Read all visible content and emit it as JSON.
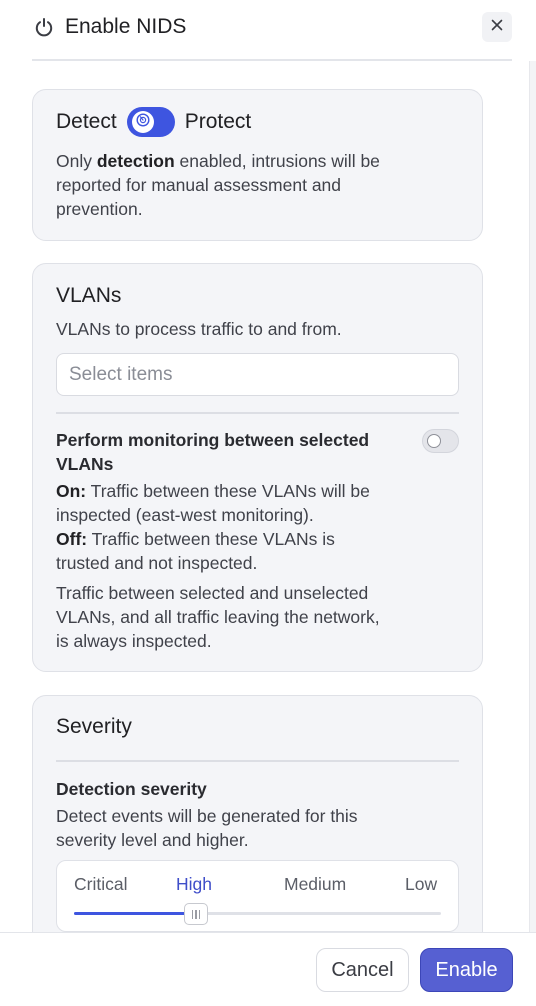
{
  "dialog": {
    "title": "Enable NIDS",
    "power_icon": "power-icon",
    "close_icon": "close-icon"
  },
  "mode": {
    "left_label": "Detect",
    "right_label": "Protect",
    "state": "detect",
    "description_pre": "Only ",
    "description_bold": "detection",
    "description_line1_post": " enabled, intrusions will be",
    "description_line2": "reported for manual assessment and",
    "description_line3": "prevention."
  },
  "vlans": {
    "title": "VLANs",
    "description": "VLANs to process traffic to and from.",
    "select_placeholder": "Select items",
    "monitoring_title": "Perform monitoring between selected VLANs",
    "monitoring_enabled": false,
    "on_label": "On:",
    "on_text_1": " Traffic between these VLANs will be",
    "on_text_2": "inspected (east-west monitoring).",
    "off_label": "Off:",
    "off_text_1": " Traffic between these VLANs is",
    "off_text_2": "trusted and not inspected.",
    "note_1": "Traffic between selected and unselected",
    "note_2": "VLANs, and all traffic leaving the network,",
    "note_3": "is always inspected."
  },
  "severity": {
    "title": "Severity",
    "detection_title": "Detection severity",
    "detection_desc_1": "Detect events will be generated for this",
    "detection_desc_2": "severity level and higher.",
    "levels": [
      "Critical",
      "High",
      "Medium",
      "Low"
    ],
    "selected": "High",
    "selected_fraction": 0.333
  },
  "footer": {
    "cancel": "Cancel",
    "enable": "Enable"
  },
  "colors": {
    "accent": "#3e55e0",
    "enable_button": "#5660d2",
    "card_bg": "#f4f5f8"
  }
}
